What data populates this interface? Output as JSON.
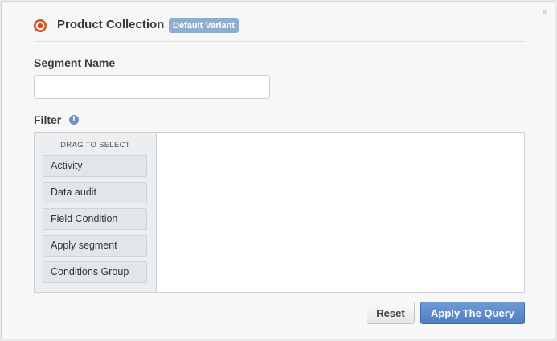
{
  "dialog": {
    "close_glyph": "×",
    "header": {
      "title": "Product Collection",
      "badge": "Default Variant",
      "icon": "radio-selected-icon",
      "icon_color": "#d8471c",
      "badge_color": "#8eaed0"
    },
    "segment_name": {
      "label": "Segment Name",
      "value": "",
      "placeholder": ""
    },
    "filter": {
      "label": "Filter",
      "info_icon": "info-icon",
      "info_glyph": "i",
      "palette_heading": "DRAG TO SELECT",
      "items": [
        {
          "label": "Activity"
        },
        {
          "label": "Data audit"
        },
        {
          "label": "Field Condition"
        },
        {
          "label": "Apply segment"
        },
        {
          "label": "Conditions Group"
        }
      ]
    },
    "buttons": {
      "reset": "Reset",
      "apply": "Apply The Query",
      "apply_color": "#5a87c9"
    }
  }
}
